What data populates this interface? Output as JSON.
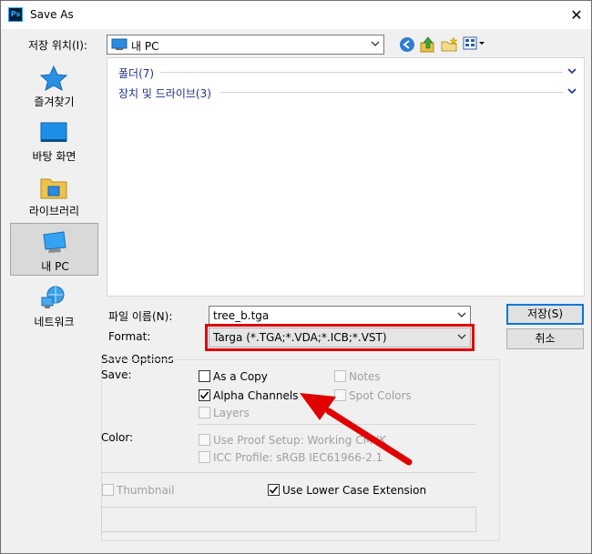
{
  "window": {
    "title": "Save As",
    "app_icon_text": "Ps"
  },
  "location": {
    "label": "저장 위치(I):",
    "value": "내 PC"
  },
  "places": [
    {
      "label": "즐겨찾기",
      "icon": "star-icon"
    },
    {
      "label": "바탕 화면",
      "icon": "desktop-icon"
    },
    {
      "label": "라이브러리",
      "icon": "library-icon"
    },
    {
      "label": "내 PC",
      "icon": "computer-icon",
      "selected": true
    },
    {
      "label": "네트워크",
      "icon": "network-icon"
    }
  ],
  "filelist": {
    "groups": [
      {
        "label": "폴더(7)"
      },
      {
        "label": "장치 및 드라이브(3)"
      }
    ]
  },
  "filename": {
    "label": "파일 이름(N):",
    "value": "tree_b.tga"
  },
  "format": {
    "label": "Format:",
    "value": "Targa (*.TGA;*.VDA;*.ICB;*.VST)"
  },
  "buttons": {
    "save": "저장(S)",
    "cancel": "취소"
  },
  "options": {
    "title": "Save Options",
    "save_label": "Save:",
    "as_copy": {
      "label": "As a Copy",
      "checked": false,
      "enabled": true
    },
    "alpha_channels": {
      "label": "Alpha Channels",
      "checked": true,
      "enabled": true
    },
    "layers": {
      "label": "Layers",
      "checked": false,
      "enabled": false
    },
    "notes": {
      "label": "Notes",
      "checked": false,
      "enabled": false
    },
    "spot_colors": {
      "label": "Spot Colors",
      "checked": false,
      "enabled": false
    },
    "color_label": "Color:",
    "use_proof": {
      "label": "Use Proof Setup:  Working CMYK",
      "checked": false,
      "enabled": false
    },
    "icc_profile": {
      "label": "ICC Profile:  sRGB IEC61966-2.1",
      "checked": false,
      "enabled": false
    },
    "thumbnail": {
      "label": "Thumbnail",
      "checked": false,
      "enabled": false
    },
    "lower_case": {
      "label": "Use Lower Case Extension",
      "checked": true,
      "enabled": true
    }
  },
  "colors": {
    "highlight": "#e00000",
    "group_text": "#1e3287"
  }
}
